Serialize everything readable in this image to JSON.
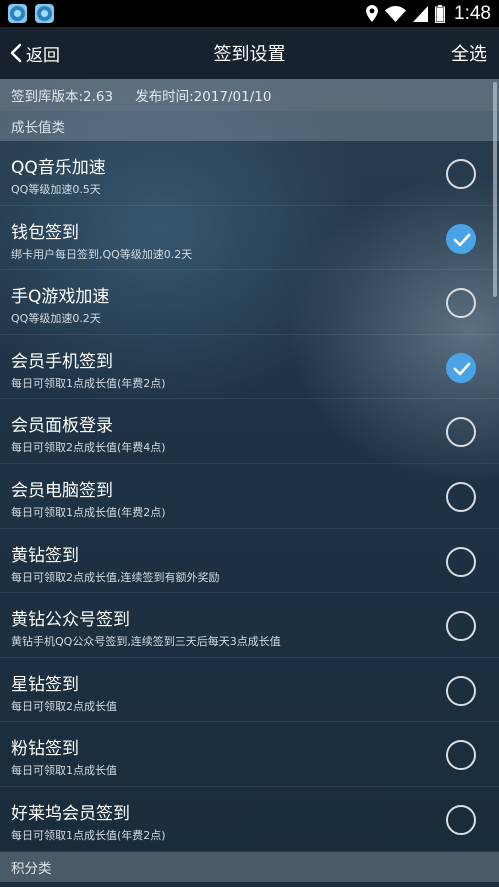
{
  "header": {
    "back_label": "返回",
    "title": "签到设置",
    "select_all": "全选"
  },
  "status_bar": {
    "time": "1:48"
  },
  "info": {
    "version": "签到库版本:2.63",
    "publish": "发布时间:2017/01/10"
  },
  "sections": {
    "growth": "成长值类",
    "points": "积分类"
  },
  "items": [
    {
      "title": "QQ音乐加速",
      "desc": "QQ等级加速0.5天",
      "checked": false
    },
    {
      "title": "钱包签到",
      "desc": "绑卡用户每日签到,QQ等级加速0.2天",
      "checked": true
    },
    {
      "title": "手Q游戏加速",
      "desc": "QQ等级加速0.2天",
      "checked": false
    },
    {
      "title": "会员手机签到",
      "desc": "每日可领取1点成长值(年费2点)",
      "checked": true
    },
    {
      "title": "会员面板登录",
      "desc": "每日可领取2点成长值(年费4点)",
      "checked": false
    },
    {
      "title": "会员电脑签到",
      "desc": "每日可领取1点成长值(年费2点)",
      "checked": false
    },
    {
      "title": "黄钻签到",
      "desc": "每日可领取2点成长值,连续签到有额外奖励",
      "checked": false
    },
    {
      "title": "黄钻公众号签到",
      "desc": "黄钻手机QQ公众号签到,连续签到三天后每天3点成长值",
      "checked": false
    },
    {
      "title": "星钻签到",
      "desc": "每日可领取2点成长值",
      "checked": false
    },
    {
      "title": "粉钻签到",
      "desc": "每日可领取1点成长值",
      "checked": false
    },
    {
      "title": "好莱坞会员签到",
      "desc": "每日可领取1点成长值(年费2点)",
      "checked": false
    }
  ],
  "colors": {
    "accent": "#4aa3e6"
  }
}
